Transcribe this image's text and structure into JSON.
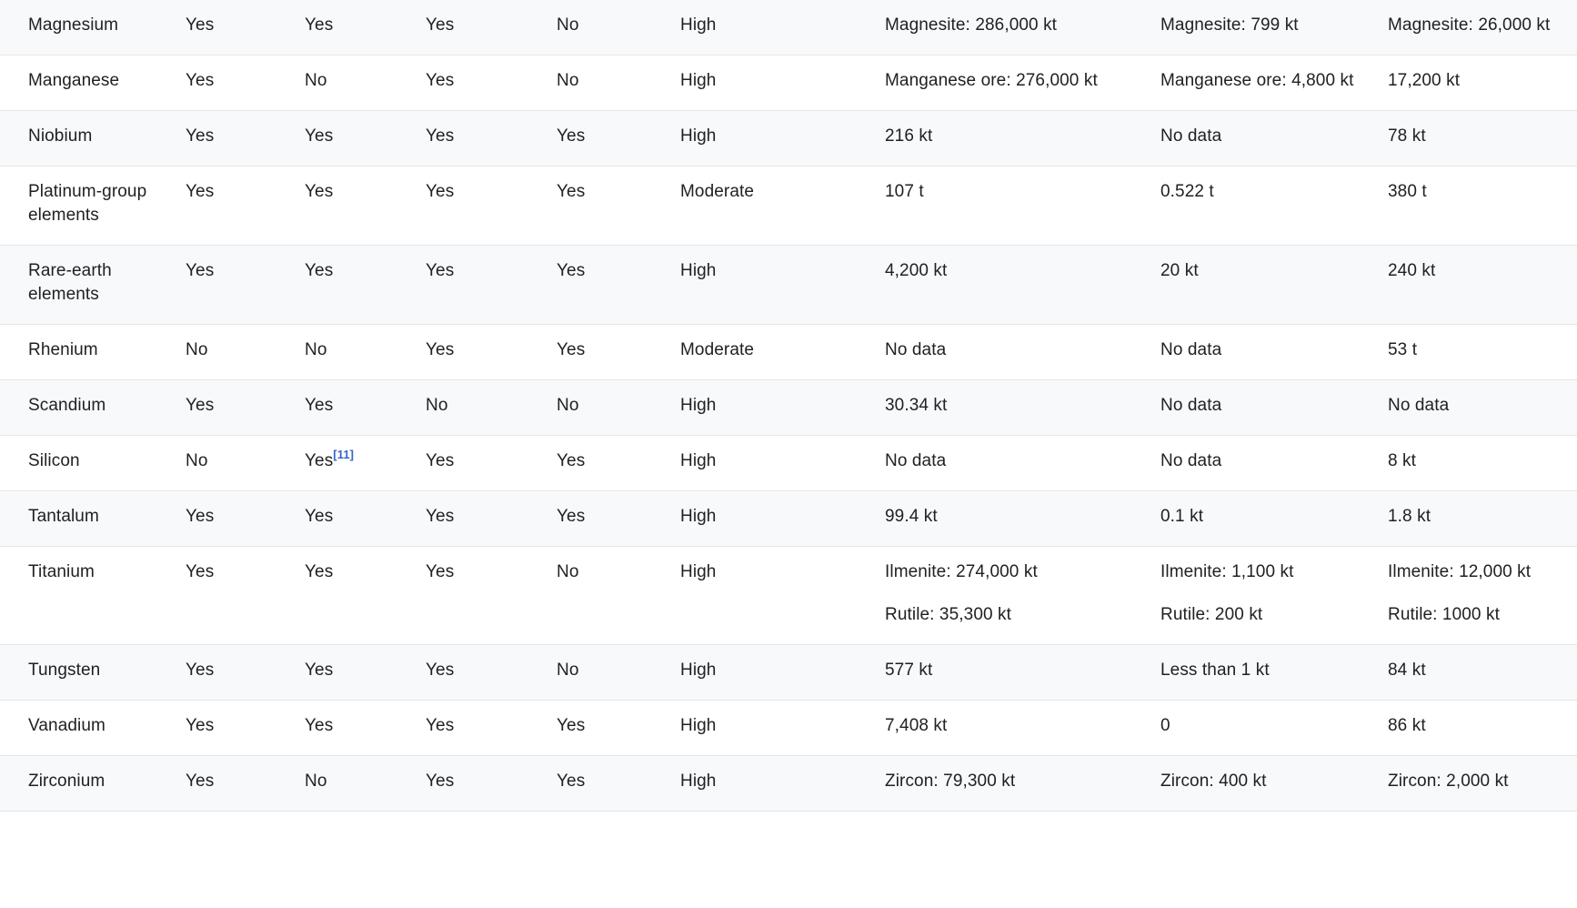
{
  "table": {
    "rows": [
      {
        "cells": [
          [
            "Magnesium"
          ],
          [
            "Yes"
          ],
          [
            "Yes"
          ],
          [
            "Yes"
          ],
          [
            "No"
          ],
          [
            "High"
          ],
          [
            "Magnesite: 286,000 kt"
          ],
          [
            "Magnesite: 799 kt"
          ],
          [
            "Magnesite: 26,000 kt"
          ]
        ]
      },
      {
        "cells": [
          [
            "Manganese"
          ],
          [
            "Yes"
          ],
          [
            "No"
          ],
          [
            "Yes"
          ],
          [
            "No"
          ],
          [
            "High"
          ],
          [
            "Manganese ore: 276,000 kt"
          ],
          [
            "Manganese ore: 4,800 kt"
          ],
          [
            "17,200 kt"
          ]
        ]
      },
      {
        "cells": [
          [
            "Niobium"
          ],
          [
            "Yes"
          ],
          [
            "Yes"
          ],
          [
            "Yes"
          ],
          [
            "Yes"
          ],
          [
            "High"
          ],
          [
            "216 kt"
          ],
          [
            "No data"
          ],
          [
            "78 kt"
          ]
        ]
      },
      {
        "cells": [
          [
            "Platinum-group elements"
          ],
          [
            "Yes"
          ],
          [
            "Yes"
          ],
          [
            "Yes"
          ],
          [
            "Yes"
          ],
          [
            "Moderate"
          ],
          [
            "107 t"
          ],
          [
            "0.522 t"
          ],
          [
            "380 t"
          ]
        ]
      },
      {
        "cells": [
          [
            "Rare-earth elements"
          ],
          [
            "Yes"
          ],
          [
            "Yes"
          ],
          [
            "Yes"
          ],
          [
            "Yes"
          ],
          [
            "High"
          ],
          [
            "4,200 kt"
          ],
          [
            "20 kt"
          ],
          [
            "240 kt"
          ]
        ]
      },
      {
        "cells": [
          [
            "Rhenium"
          ],
          [
            "No"
          ],
          [
            "No"
          ],
          [
            "Yes"
          ],
          [
            "Yes"
          ],
          [
            "Moderate"
          ],
          [
            "No data"
          ],
          [
            "No data"
          ],
          [
            "53 t"
          ]
        ]
      },
      {
        "cells": [
          [
            "Scandium"
          ],
          [
            "Yes"
          ],
          [
            "Yes"
          ],
          [
            "No"
          ],
          [
            "No"
          ],
          [
            "High"
          ],
          [
            "30.34 kt"
          ],
          [
            "No data"
          ],
          [
            "No data"
          ]
        ]
      },
      {
        "cells": [
          [
            "Silicon"
          ],
          [
            "No"
          ],
          [
            "Yes"
          ],
          [
            "Yes"
          ],
          [
            "Yes"
          ],
          [
            "High"
          ],
          [
            "No data"
          ],
          [
            "No data"
          ],
          [
            "8 kt"
          ]
        ],
        "refs": {
          "2": "[11]"
        }
      },
      {
        "cells": [
          [
            "Tantalum"
          ],
          [
            "Yes"
          ],
          [
            "Yes"
          ],
          [
            "Yes"
          ],
          [
            "Yes"
          ],
          [
            "High"
          ],
          [
            "99.4 kt"
          ],
          [
            "0.1 kt"
          ],
          [
            "1.8 kt"
          ]
        ]
      },
      {
        "cells": [
          [
            "Titanium"
          ],
          [
            "Yes"
          ],
          [
            "Yes"
          ],
          [
            "Yes"
          ],
          [
            "No"
          ],
          [
            "High"
          ],
          [
            "Ilmenite: 274,000 kt",
            "Rutile: 35,300 kt"
          ],
          [
            "Ilmenite: 1,100 kt",
            "Rutile: 200 kt"
          ],
          [
            "Ilmenite: 12,000 kt",
            "Rutile: 1000 kt"
          ]
        ]
      },
      {
        "cells": [
          [
            "Tungsten"
          ],
          [
            "Yes"
          ],
          [
            "Yes"
          ],
          [
            "Yes"
          ],
          [
            "No"
          ],
          [
            "High"
          ],
          [
            "577 kt"
          ],
          [
            "Less than 1 kt"
          ],
          [
            "84 kt"
          ]
        ]
      },
      {
        "cells": [
          [
            "Vanadium"
          ],
          [
            "Yes"
          ],
          [
            "Yes"
          ],
          [
            "Yes"
          ],
          [
            "Yes"
          ],
          [
            "High"
          ],
          [
            "7,408 kt"
          ],
          [
            "0"
          ],
          [
            "86 kt"
          ]
        ]
      },
      {
        "cells": [
          [
            "Zirconium"
          ],
          [
            "Yes"
          ],
          [
            "No"
          ],
          [
            "Yes"
          ],
          [
            "Yes"
          ],
          [
            "High"
          ],
          [
            "Zircon: 79,300 kt"
          ],
          [
            "Zircon: 400 kt"
          ],
          [
            "Zircon: 2,000 kt"
          ]
        ]
      }
    ]
  }
}
